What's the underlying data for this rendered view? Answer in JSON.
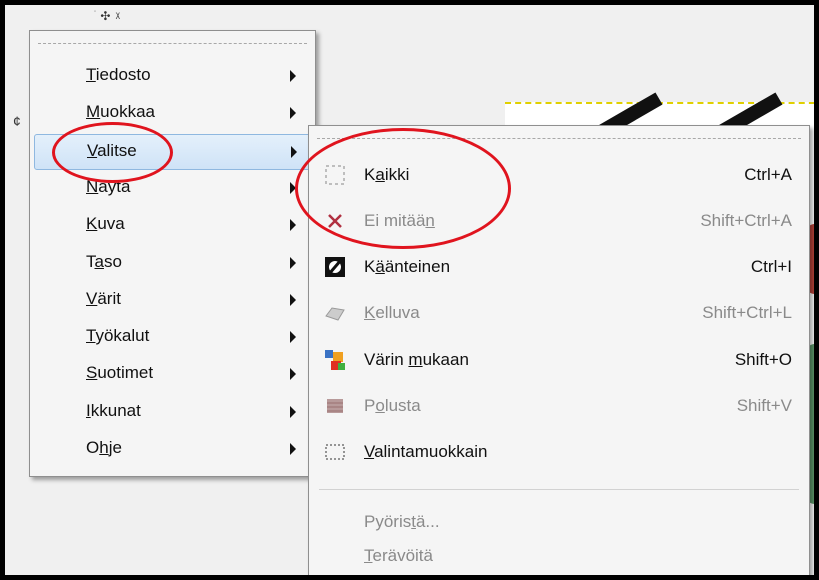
{
  "main_menu": {
    "items": [
      {
        "pre": "",
        "u": "T",
        "post": "iedosto"
      },
      {
        "pre": "",
        "u": "M",
        "post": "uokkaa"
      },
      {
        "pre": "",
        "u": "V",
        "post": "alitse"
      },
      {
        "pre": "",
        "u": "N",
        "post": "äytä"
      },
      {
        "pre": "",
        "u": "K",
        "post": "uva"
      },
      {
        "pre": "T",
        "u": "a",
        "post": "so"
      },
      {
        "pre": "",
        "u": "V",
        "post": "ärit"
      },
      {
        "pre": "",
        "u": "T",
        "post": "yökalut"
      },
      {
        "pre": "",
        "u": "S",
        "post": "uotimet"
      },
      {
        "pre": "",
        "u": "I",
        "post": "kkunat"
      },
      {
        "pre": "O",
        "u": "h",
        "post": "je"
      }
    ],
    "highlighted_index": 2
  },
  "submenu": {
    "items": [
      {
        "pre": "K",
        "u": "a",
        "post": "ikki",
        "accel": "Ctrl+A",
        "disabled": false,
        "icon": "select-all-icon"
      },
      {
        "pre": "Ei mitää",
        "u": "n",
        "post": "",
        "accel": "Shift+Ctrl+A",
        "disabled": true,
        "icon": "select-none-icon"
      },
      {
        "pre": "K",
        "u": "ä",
        "post": "änteinen",
        "accel": "Ctrl+I",
        "disabled": false,
        "icon": "invert-selection-icon"
      },
      {
        "pre": "",
        "u": "K",
        "post": "elluva",
        "accel": "Shift+Ctrl+L",
        "disabled": true,
        "icon": "float-selection-icon"
      },
      {
        "pre": "Värin ",
        "u": "m",
        "post": "ukaan",
        "accel": "Shift+O",
        "disabled": false,
        "icon": "by-color-select-icon"
      },
      {
        "pre": "P",
        "u": "o",
        "post": "lusta",
        "accel": "Shift+V",
        "disabled": true,
        "icon": "from-path-icon"
      },
      {
        "pre": "",
        "u": "V",
        "post": "alintamuokkain",
        "accel": "",
        "disabled": false,
        "icon": "selection-editor-icon"
      },
      {
        "pre": "Pyöris",
        "u": "t",
        "post": "ä...",
        "accel": "",
        "disabled": true,
        "icon": ""
      },
      {
        "pre": "",
        "u": "T",
        "post": "erävöitä",
        "accel": "",
        "disabled": true,
        "icon": ""
      }
    ]
  },
  "colors": {
    "highlight": "#cfe3f7",
    "annotation": "#e0141e",
    "disabled_text": "#8a8a8a"
  }
}
